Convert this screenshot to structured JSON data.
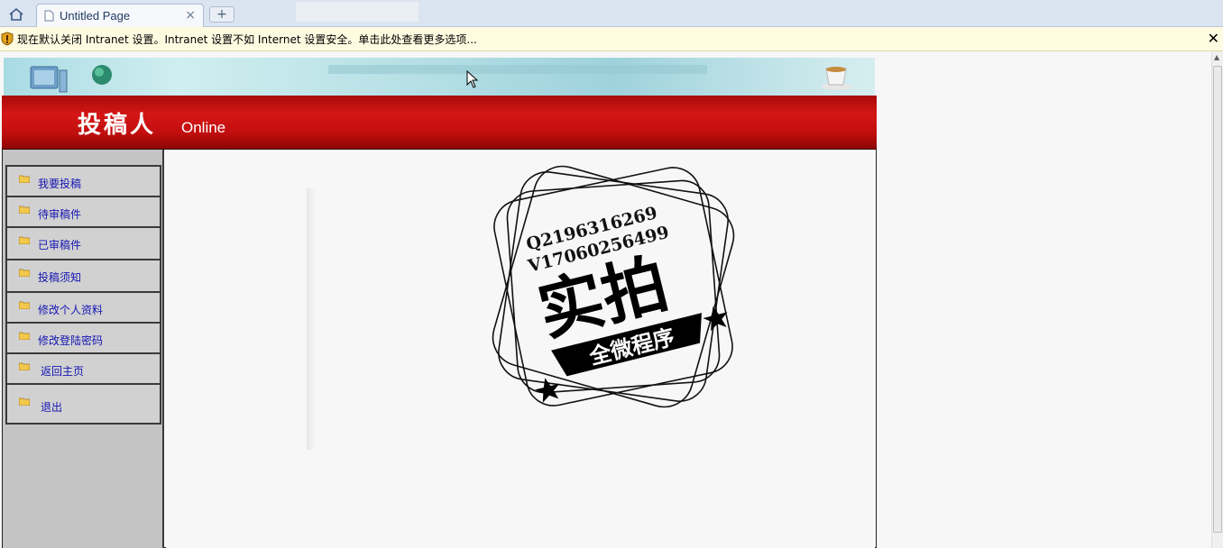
{
  "browser": {
    "tab_title": "Untitled Page",
    "close_glyph": "×",
    "newtab_glyph": "+",
    "icons": [
      "home-icon",
      "page-icon",
      "close-icon",
      "new-tab-icon"
    ]
  },
  "infobar": {
    "message": "现在默认关闭 Intranet 设置。Intranet 设置不如 Internet 设置安全。单击此处查看更多选项...",
    "close_glyph": "✕",
    "icon": "shield-warning-icon"
  },
  "header": {
    "logo_cn": "投稿人",
    "logo_en": "Online",
    "colors": {
      "banner_red": "#c20e0e",
      "banner_sky": "#b8e1e6"
    }
  },
  "sidebar": {
    "items": [
      {
        "label": "我要投稿"
      },
      {
        "label": "待审稿件"
      },
      {
        "label": "已审稿件"
      },
      {
        "label": "投稿须知"
      },
      {
        "label": "修改个人资料"
      },
      {
        "label": "修改登陆密码"
      },
      {
        "label": "返回主页"
      },
      {
        "label": "退出"
      }
    ],
    "item_icon": "folder-icon",
    "link_color": "#1414b4"
  },
  "watermark": {
    "line1": "Q2196316269",
    "line2": "V17060256499",
    "main": "实拍",
    "ribbon": "全微程序"
  }
}
